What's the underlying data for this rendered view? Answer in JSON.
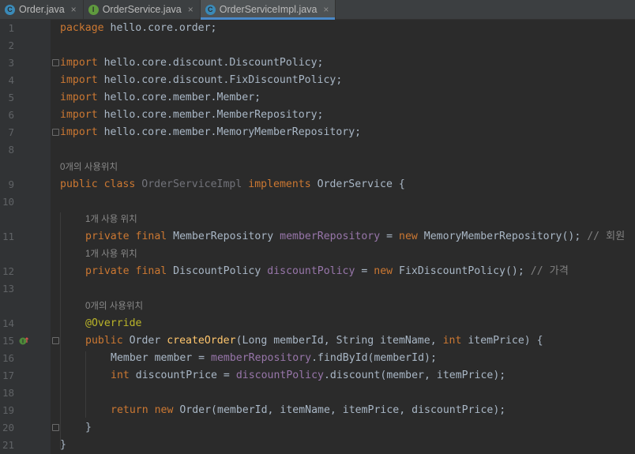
{
  "tabs": [
    {
      "label": "Order.java",
      "icon": "class-icon",
      "icon_letter": "C",
      "close": "×",
      "active": false
    },
    {
      "label": "OrderService.java",
      "icon": "interface-icon",
      "icon_letter": "I",
      "close": "×",
      "active": false
    },
    {
      "label": "OrderServiceImpl.java",
      "icon": "class-icon",
      "icon_letter": "C",
      "close": "×",
      "active": true
    }
  ],
  "colors": {
    "background": "#2b2b2b",
    "keyword": "#cc7832",
    "field": "#9876aa",
    "method": "#ffc66d",
    "annotation": "#bbb529",
    "comment": "#808080",
    "accent": "#4a88c7"
  },
  "line_numbers": [
    "1",
    "2",
    "3",
    "4",
    "5",
    "6",
    "7",
    "8",
    "9",
    "10",
    "11",
    "12",
    "13",
    "14",
    "15",
    "16",
    "17",
    "18",
    "19",
    "20",
    "21"
  ],
  "hints": {
    "class_usages": "0개의 사용위치",
    "field1_usages": "1개 사용 위치",
    "field2_usages": "1개 사용 위치",
    "method_usages": "0개의 사용위치"
  },
  "code": {
    "l1_kw": "package",
    "l1_rest": " hello.core.order;",
    "imports": [
      {
        "kw": "import",
        "path": " hello.core.discount.DiscountPolicy;"
      },
      {
        "kw": "import",
        "path": " hello.core.discount.FixDiscountPolicy;"
      },
      {
        "kw": "import",
        "path": " hello.core.member.Member;"
      },
      {
        "kw": "import",
        "path": " hello.core.member.MemberRepository;"
      },
      {
        "kw": "import",
        "path": " hello.core.member.MemoryMemberRepository;"
      }
    ],
    "l9_public": "public",
    "l9_class": "class",
    "l9_name": "OrderServiceImpl",
    "l9_implements": "implements",
    "l9_iface": "OrderService",
    "l9_brace": " {",
    "l11_mods": "private final",
    "l11_type": " MemberRepository ",
    "l11_field": "memberRepository",
    "l11_eq": " = ",
    "l11_new": "new",
    "l11_ctor": " MemoryMemberRepository();",
    "l11_comment": " // 회원",
    "l12_mods": "private final",
    "l12_type": " DiscountPolicy ",
    "l12_field": "discountPolicy",
    "l12_eq": " = ",
    "l12_new": "new",
    "l12_ctor": " FixDiscountPolicy();",
    "l12_comment": " // 가격",
    "l14_ann": "@Override",
    "l15_public": "public",
    "l15_ret": " Order ",
    "l15_method": "createOrder",
    "l15_p1": "(Long memberId, String itemName, ",
    "l15_int": "int",
    "l15_p2": " itemPrice) {",
    "l16_pre": "Member member = ",
    "l16_field": "memberRepository",
    "l16_post": ".findById(memberId);",
    "l17_int": "int",
    "l17_pre": " discountPrice = ",
    "l17_field": "discountPolicy",
    "l17_post": ".discount(member, itemPrice);",
    "l19_return": "return",
    "l19_new": "new",
    "l19_post": " Order(memberId, itemName, itemPrice, discountPrice);",
    "l20": "}",
    "l21": "}"
  }
}
